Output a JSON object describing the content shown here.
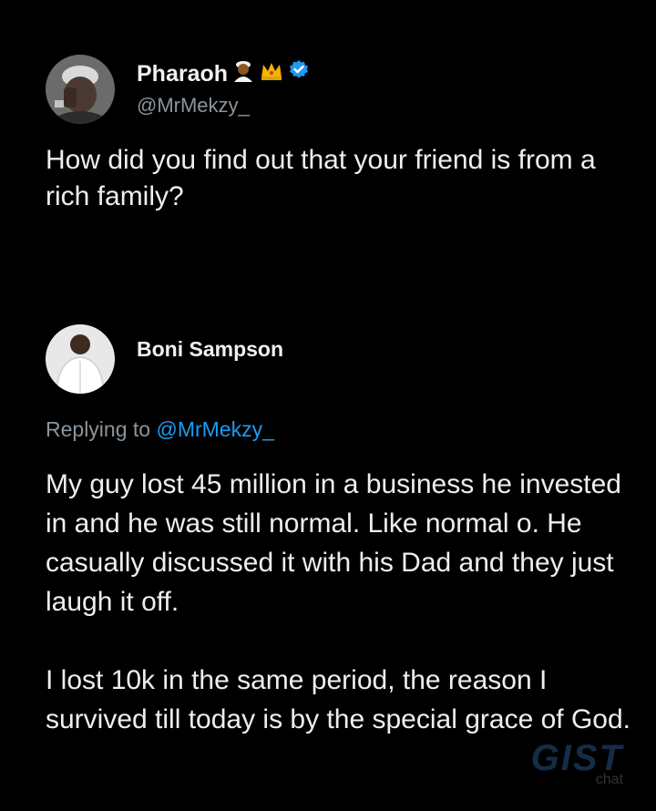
{
  "original_tweet": {
    "display_name": "Pharaoh",
    "badges": [
      "person-emoji-icon",
      "crown-emoji-icon",
      "verified-badge-icon"
    ],
    "handle": "@MrMekzy_",
    "text": "How did you find out that your friend is from a rich family?"
  },
  "reply": {
    "display_name": "Boni Sampson",
    "replying_prefix": "Replying to",
    "replying_mention": "@MrMekzy_",
    "paragraphs": [
      "My guy lost 45 million in a business he invested in and he was still normal. Like normal o. He casually discussed it with his Dad and they just laugh it off.",
      "I lost 10k in the same period, the reason I survived till today is by the special grace of God."
    ]
  },
  "watermark": {
    "main": "GIST",
    "sub": "chat"
  },
  "colors": {
    "background": "#000000",
    "text": "#eceff1",
    "muted": "#8b949b",
    "link": "#1d9bf0",
    "verified": "#1d9bf0"
  }
}
